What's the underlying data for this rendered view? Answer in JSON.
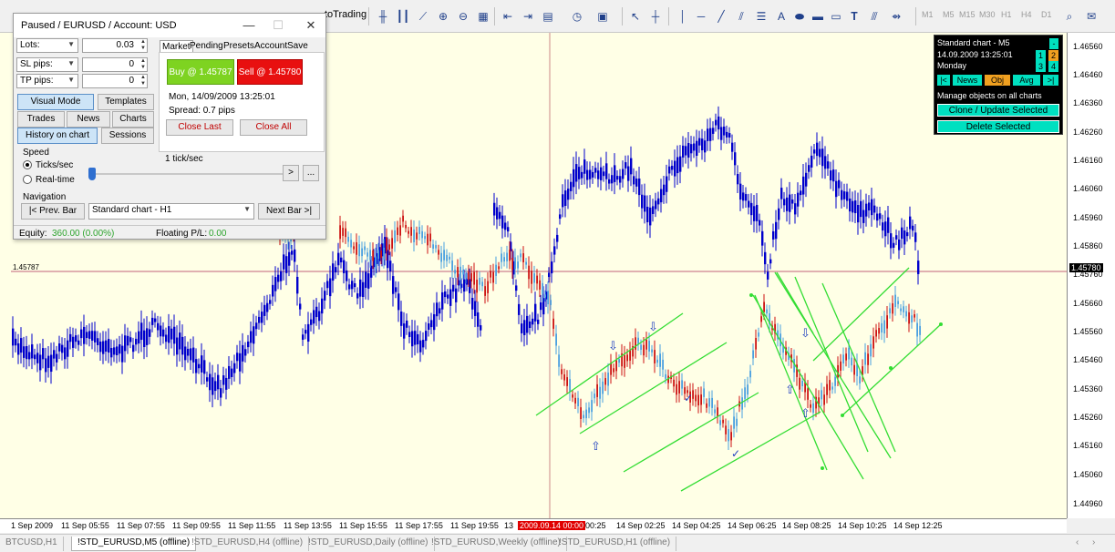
{
  "toolbar": {
    "autotrading_label": "toTrading",
    "timeframes": [
      "M1",
      "M5",
      "M15",
      "M30",
      "H1",
      "H4",
      "D1"
    ]
  },
  "panel": {
    "title": "Paused / EURUSD / Account: USD",
    "lots_label": "Lots:",
    "lots_value": "0.03",
    "sl_label": "SL pips:",
    "sl_value": "0",
    "tp_label": "TP pips:",
    "tp_value": "0",
    "tabs": [
      "Market",
      "Pending",
      "Presets",
      "Account",
      "Save"
    ],
    "buttons": {
      "visual_mode": "Visual Mode",
      "templates": "Templates",
      "trades": "Trades",
      "news": "News",
      "charts": "Charts",
      "history_on_chart": "History on chart",
      "sessions": "Sessions"
    },
    "buy_label": "Buy @ 1.45787",
    "sell_label": "Sell @ 1.45780",
    "datetime": "Mon, 14/09/2009  13:25:01",
    "spread": "Spread: 0.7 pips",
    "close_last": "Close Last",
    "close_all": "Close All",
    "speed_label": "Speed",
    "ticks_label": "Ticks/sec",
    "realtime_label": "Real-time",
    "speed_value": "1 tick/sec",
    "play_label": ">",
    "more_label": "...",
    "navigation_label": "Navigation",
    "prev_bar": "|< Prev. Bar",
    "chart_select": "Standard chart - H1",
    "next_bar": "Next Bar >|",
    "equity_label": "Equity:",
    "equity_value": "360.00  (0.00%)",
    "floating_label": "Floating P/L:",
    "floating_value": "0.00"
  },
  "infobox": {
    "chart_name": "Standard chart - M5",
    "minus": "-",
    "datetime": "14.09.2009  13:25:01",
    "day": "Monday",
    "nums": [
      "1",
      "2",
      "3",
      "4"
    ],
    "nav_prev": "|<",
    "news": "News",
    "obj": "Obj",
    "avg": "Avg",
    "nav_next": ">|",
    "manage_label": "Manage objects on all charts",
    "clone_btn": "Clone / Update Selected",
    "delete_btn": "Delete Selected"
  },
  "price_scale": {
    "labels": [
      "1.46560",
      "1.46460",
      "1.46360",
      "1.46260",
      "1.46160",
      "1.46060",
      "1.45960",
      "1.45860",
      "1.45780",
      "1.45760",
      "1.45660",
      "1.45560",
      "1.45460",
      "1.45360",
      "1.45260",
      "1.45160",
      "1.45060",
      "1.44960"
    ],
    "current": "1.45780",
    "left_marker": "1.45787"
  },
  "time_axis": {
    "labels": [
      "1 Sep 2009",
      "11 Sep 05:55",
      "11 Sep 07:55",
      "11 Sep 09:55",
      "11 Sep 11:55",
      "11 Sep 13:55",
      "11 Sep 15:55",
      "11 Sep 17:55",
      "11 Sep 19:55",
      "13",
      "2009.09.14 00:00",
      "00:25",
      "14 Sep 02:25",
      "14 Sep 04:25",
      "14 Sep 06:25",
      "14 Sep 08:25",
      "14 Sep 10:25",
      "14 Sep 12:25"
    ]
  },
  "tabs": [
    "BTCUSD,H1",
    "!STD_EURUSD,M5 (offline)",
    "!STD_EURUSD,H4 (offline)",
    "!STD_EURUSD,Daily (offline)",
    "!STD_EURUSD,Weekly (offline)",
    "!STD_EURUSD,H1 (offline)"
  ],
  "tab_nav": [
    "‹",
    "›"
  ],
  "colors": {
    "chart_bg": "#ffffe6",
    "blue_series": "#0000cc",
    "red_candles": "#cc1111",
    "light_blue_candles": "#4aa0e0",
    "channel_lines": "#33dd33",
    "current_price_line": "#e0b0b0"
  }
}
